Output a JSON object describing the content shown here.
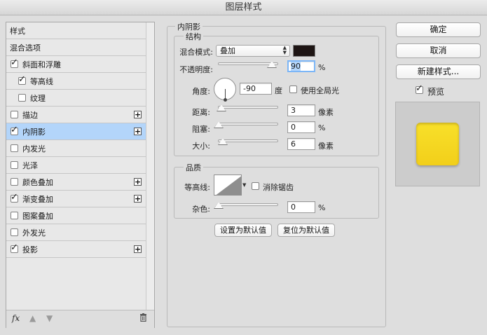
{
  "window": {
    "title": "图层样式"
  },
  "sidebar": {
    "items": [
      {
        "label": "样式",
        "checkbox": false,
        "checked": false,
        "plus": false,
        "selected": false
      },
      {
        "label": "混合选项",
        "checkbox": false,
        "checked": false,
        "plus": false,
        "selected": false
      },
      {
        "label": "斜面和浮雕",
        "checkbox": true,
        "checked": true,
        "plus": false,
        "selected": false
      },
      {
        "label": "等高线",
        "checkbox": true,
        "checked": true,
        "plus": false,
        "selected": false,
        "indent": true
      },
      {
        "label": "纹理",
        "checkbox": true,
        "checked": false,
        "plus": false,
        "selected": false,
        "indent": true
      },
      {
        "label": "描边",
        "checkbox": true,
        "checked": false,
        "plus": true,
        "selected": false
      },
      {
        "label": "内阴影",
        "checkbox": true,
        "checked": true,
        "plus": true,
        "selected": true
      },
      {
        "label": "内发光",
        "checkbox": true,
        "checked": false,
        "plus": false,
        "selected": false
      },
      {
        "label": "光泽",
        "checkbox": true,
        "checked": false,
        "plus": false,
        "selected": false
      },
      {
        "label": "颜色叠加",
        "checkbox": true,
        "checked": false,
        "plus": true,
        "selected": false
      },
      {
        "label": "渐变叠加",
        "checkbox": true,
        "checked": true,
        "plus": true,
        "selected": false
      },
      {
        "label": "图案叠加",
        "checkbox": true,
        "checked": false,
        "plus": false,
        "selected": false
      },
      {
        "label": "外发光",
        "checkbox": true,
        "checked": false,
        "plus": false,
        "selected": false
      },
      {
        "label": "投影",
        "checkbox": true,
        "checked": true,
        "plus": true,
        "selected": false
      }
    ],
    "footer": {
      "fx": "fx",
      "up_icon": "arrow-up-icon",
      "down_icon": "arrow-down-icon",
      "trash_icon": "trash-icon"
    }
  },
  "inner_shadow": {
    "title": "内阴影",
    "structure": {
      "title": "结构",
      "blend_mode_label": "混合模式:",
      "blend_mode_value": "叠加",
      "shadow_color": "#1e1514",
      "opacity_label": "不透明度:",
      "opacity_value": "90",
      "opacity_unit": "%",
      "angle_label": "角度:",
      "angle_value": "-90",
      "angle_unit": "度",
      "global_light_label": "使用全局光",
      "global_light_checked": false,
      "distance_label": "距离:",
      "distance_value": "3",
      "distance_unit": "像素",
      "choke_label": "阻塞:",
      "choke_value": "0",
      "choke_unit": "%",
      "size_label": "大小:",
      "size_value": "6",
      "size_unit": "像素"
    },
    "quality": {
      "title": "品质",
      "contour_label": "等高线:",
      "anti_alias_label": "消除锯齿",
      "anti_alias_checked": false,
      "noise_label": "杂色:",
      "noise_value": "0",
      "noise_unit": "%"
    },
    "make_default_label": "设置为默认值",
    "reset_default_label": "复位为默认值"
  },
  "actions": {
    "ok_label": "确定",
    "cancel_label": "取消",
    "new_style_label": "新建样式...",
    "preview_label": "预览",
    "preview_checked": true,
    "preview_color": "#f5d621"
  }
}
